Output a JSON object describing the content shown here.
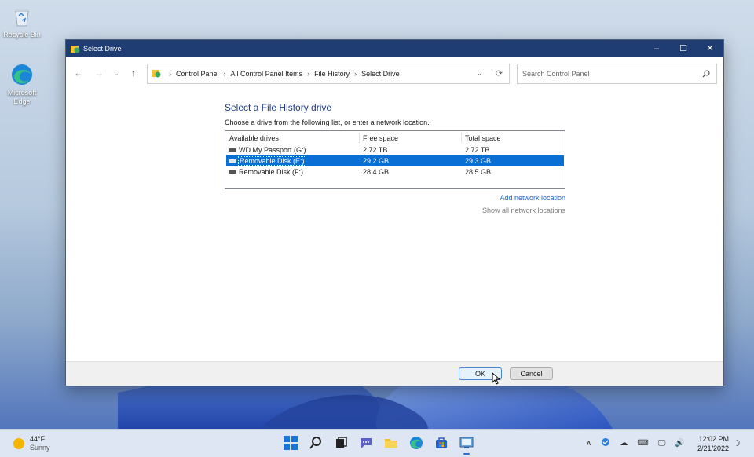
{
  "desktop": {
    "icons": [
      {
        "label": "Recycle Bin",
        "icon": "recycle-bin-icon"
      },
      {
        "label": "Microsoft Edge",
        "icon": "edge-icon"
      }
    ]
  },
  "window": {
    "title": "Select Drive",
    "controls": {
      "minimize": "–",
      "maximize": "☐",
      "close": "✕"
    }
  },
  "address_bar": {
    "breadcrumbs": [
      "Control Panel",
      "All Control Panel Items",
      "File History",
      "Select Drive"
    ],
    "search_placeholder": "Search Control Panel"
  },
  "main": {
    "heading": "Select a File History drive",
    "instruction": "Choose a drive from the following list, or enter a network location.",
    "columns": [
      "Available drives",
      "Free space",
      "Total space"
    ],
    "drives": [
      {
        "name": "WD My Passport (G:)",
        "free": "2.72 TB",
        "total": "2.72 TB",
        "selected": false
      },
      {
        "name": "Removable Disk (E:)",
        "free": "29.2 GB",
        "total": "29.3 GB",
        "selected": true
      },
      {
        "name": "Removable Disk (F:)",
        "free": "28.4 GB",
        "total": "28.5 GB",
        "selected": false
      }
    ],
    "add_network_location": "Add network location",
    "show_all_network_locations": "Show all network locations"
  },
  "footer": {
    "ok_label": "OK",
    "cancel_label": "Cancel"
  },
  "taskbar": {
    "weather": {
      "temp": "44°F",
      "condition": "Sunny"
    },
    "clock": {
      "time": "12:02 PM",
      "date": "2/21/2022"
    }
  },
  "colors": {
    "title_bar": "#1f3c73",
    "selection": "#0a6fd4",
    "link": "#1f63c8",
    "heading": "#1e3a8a"
  }
}
